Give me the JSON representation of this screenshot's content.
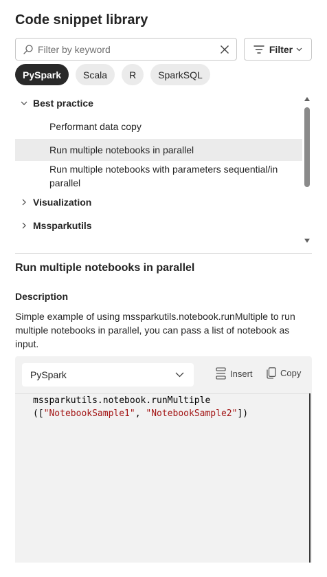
{
  "panel": {
    "title": "Code snippet library"
  },
  "search": {
    "placeholder": "Filter by keyword"
  },
  "filter": {
    "label": "Filter"
  },
  "chips": [
    {
      "label": "PySpark",
      "active": true
    },
    {
      "label": "Scala",
      "active": false
    },
    {
      "label": "R",
      "active": false
    },
    {
      "label": "SparkSQL",
      "active": false
    }
  ],
  "tree": {
    "groups": [
      {
        "label": "Best practice",
        "expanded": true
      },
      {
        "label": "Visualization",
        "expanded": false
      },
      {
        "label": "Mssparkutils",
        "expanded": false
      }
    ],
    "items": [
      {
        "label": "Performant data copy"
      },
      {
        "label": "Run multiple notebooks in parallel",
        "selected": true
      },
      {
        "label": "Run multiple notebooks with parameters sequential/in parallel"
      }
    ]
  },
  "snippet": {
    "title": "Run multiple notebooks in parallel",
    "description_label": "Description",
    "description": "Simple example of using mssparkutils.notebook.runMultiple to run multiple notebooks in parallel, you can pass a list of notebook as input."
  },
  "code": {
    "language": "PySpark",
    "insert_label": "Insert",
    "copy_label": "Copy",
    "line1": "mssparkutils.notebook.runMultiple",
    "line2_open": "([",
    "line2_str1": "\"NotebookSample1\"",
    "line2_sep": ", ",
    "line2_str2": "\"NotebookSample2\"",
    "line2_close": "])"
  },
  "colors": {
    "chip_active_bg": "#292929",
    "selected_row_bg": "#ebebeb",
    "code_panel_bg": "#f2f2f2",
    "string_color": "#a31515"
  }
}
